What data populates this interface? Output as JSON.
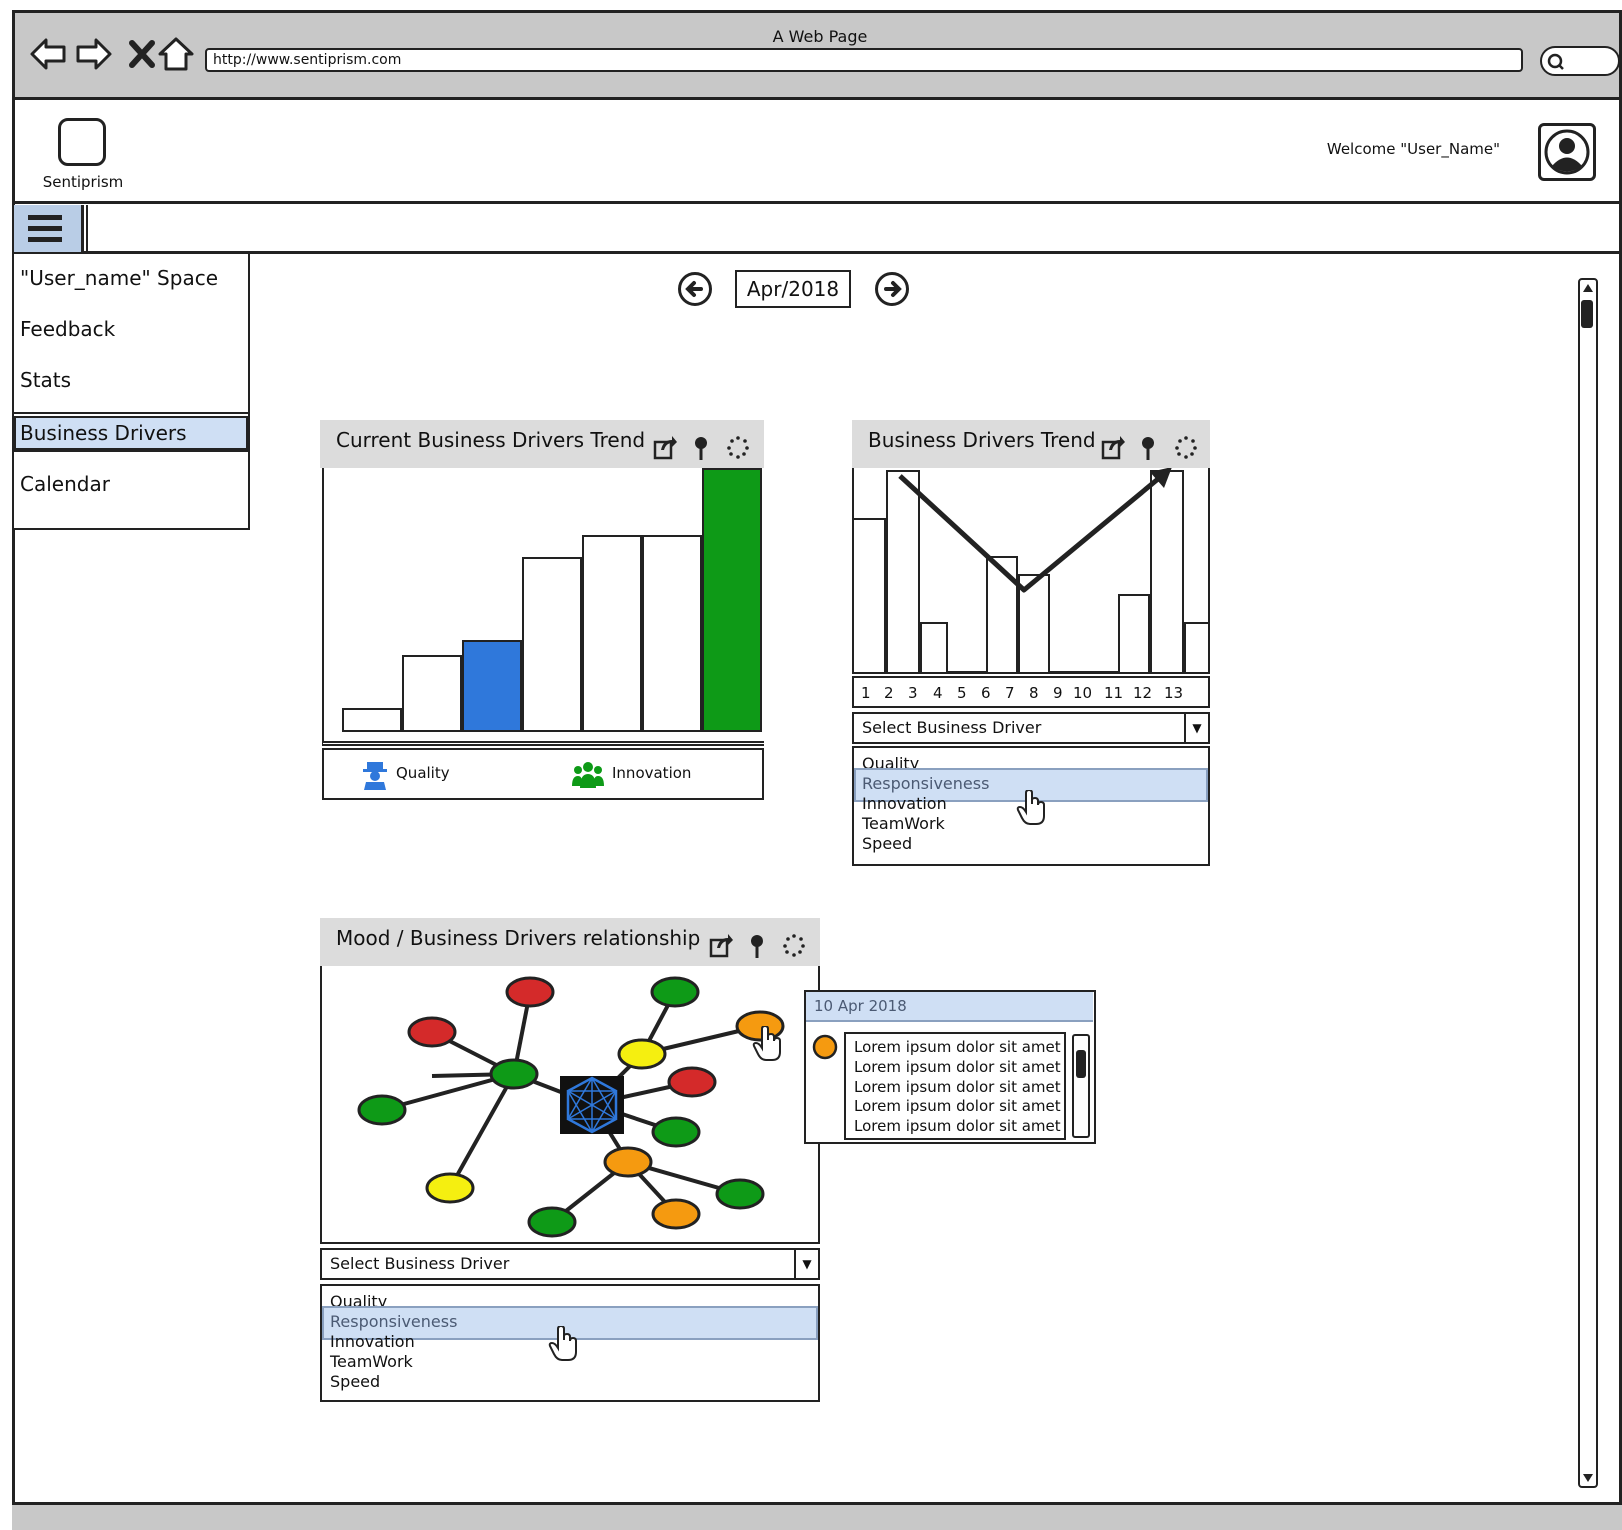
{
  "window": {
    "title": "A Web Page",
    "url": "http://www.sentiprism.com"
  },
  "header": {
    "logo_text": "Sentiprism",
    "welcome": "Welcome \"User_Name\""
  },
  "sidebar": {
    "items": [
      {
        "label": "\"User_name\" Space"
      },
      {
        "label": "Feedback"
      },
      {
        "label": "Stats"
      },
      {
        "label": "Business Drivers",
        "active": true
      },
      {
        "label": "Calendar"
      }
    ]
  },
  "date_nav": {
    "current": "Apr/2018"
  },
  "panel_current": {
    "title": "Current Business Drivers Trend",
    "legend": [
      {
        "label": "Quality",
        "color": "#2f78db"
      },
      {
        "label": "Innovation",
        "color": "#0e9a17"
      }
    ]
  },
  "panel_trend": {
    "title": "Business Drivers Trend",
    "ticks": [
      "1",
      "2",
      "3",
      "4",
      "5",
      "6",
      "7",
      "8",
      "9",
      "10",
      "11",
      "12",
      "13"
    ],
    "select_label": "Select Business Driver",
    "options": [
      "Quality",
      "Responsiveness",
      "Innovation",
      "TeamWork",
      "Speed"
    ],
    "highlighted": "Responsiveness"
  },
  "panel_mood": {
    "title": "Mood / Business Drivers relationship",
    "select_label": "Select Business Driver",
    "options": [
      "Quality",
      "Responsiveness",
      "Innovation",
      "TeamWork",
      "Speed"
    ],
    "highlighted": "Responsiveness"
  },
  "popup": {
    "date": "10 Apr 2018",
    "lines": [
      "Lorem ipsum dolor sit amet",
      "Lorem ipsum dolor sit amet",
      "Lorem ipsum dolor sit amet",
      "Lorem ipsum dolor sit amet",
      "Lorem ipsum dolor sit amet"
    ]
  },
  "colors": {
    "highlight": "#cfdff4",
    "blue_bar": "#2f78db",
    "green_bar": "#0e9a17",
    "node_red": "#d42a2a",
    "node_green": "#0e9a17",
    "node_yellow": "#f5ef10",
    "node_orange": "#f59a10"
  }
}
